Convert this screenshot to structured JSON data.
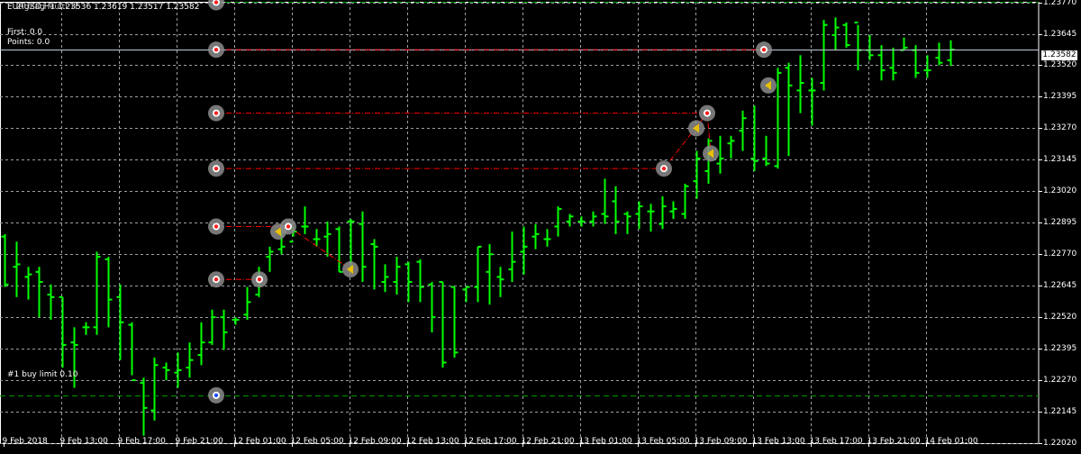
{
  "header": {
    "symbol_line": "EURUSD,H1  1.23536 1.23619 1.23517 1.23582",
    "title_overlay": "ZigZag Multi TF",
    "first_label": "First: 0.0",
    "points_label": "Points: 0.0"
  },
  "order": {
    "label": "#1 buy limit 0.10",
    "price": 1.2221
  },
  "colors": {
    "background": "#000000",
    "bar": "#00ff00",
    "grid": "#9aa0a6",
    "current_price_line": "#c0c8d8",
    "zigzag_line": "#ff0000",
    "order_line": "#009900"
  },
  "chart_data": {
    "type": "ohlc",
    "symbol": "EURUSD",
    "timeframe": "H1",
    "current_price": 1.23582,
    "current_price_label": "1.23582",
    "ylim": [
      1.2202,
      1.23772
    ],
    "y_ticks": [
      "1.23770",
      "1.23645",
      "1.23520",
      "1.23395",
      "1.23270",
      "1.23145",
      "1.23020",
      "1.22895",
      "1.22770",
      "1.22645",
      "1.22520",
      "1.22395",
      "1.22270",
      "1.22145",
      "1.22020"
    ],
    "x_labels": [
      "9 Feb 2018",
      "9 Feb 13:00",
      "9 Feb 17:00",
      "9 Feb 21:00",
      "12 Feb 01:00",
      "12 Feb 05:00",
      "12 Feb 09:00",
      "12 Feb 13:00",
      "12 Feb 17:00",
      "12 Feb 21:00",
      "13 Feb 01:00",
      "13 Feb 05:00",
      "13 Feb 09:00",
      "13 Feb 13:00",
      "13 Feb 17:00",
      "13 Feb 21:00",
      "14 Feb 01:00"
    ],
    "bars": [
      [
        1.2284,
        1.2285,
        1.2264,
        1.2265
      ],
      [
        1.2272,
        1.2282,
        1.226,
        1.2273
      ],
      [
        1.2268,
        1.2272,
        1.2259,
        1.2269
      ],
      [
        1.227,
        1.2272,
        1.2252,
        1.2266
      ],
      [
        1.2261,
        1.2265,
        1.2251,
        1.226
      ],
      [
        1.226,
        1.226,
        1.2232,
        1.2241
      ],
      [
        1.2242,
        1.2248,
        1.2224,
        1.2241
      ],
      [
        1.2248,
        1.225,
        1.2245,
        1.2248
      ],
      [
        1.2248,
        1.2278,
        1.2245,
        1.2276
      ],
      [
        1.2275,
        1.2276,
        1.2248,
        1.2259
      ],
      [
        1.226,
        1.2265,
        1.2235,
        1.225
      ],
      [
        1.2249,
        1.225,
        1.2229,
        1.2227
      ],
      [
        1.2226,
        1.2228,
        1.2205,
        1.2216
      ],
      [
        1.2215,
        1.2236,
        1.2211,
        1.2233
      ],
      [
        1.2232,
        1.2234,
        1.2227,
        1.2231
      ],
      [
        1.223,
        1.2238,
        1.2224,
        1.2231
      ],
      [
        1.2232,
        1.2242,
        1.2228,
        1.2235
      ],
      [
        1.2237,
        1.225,
        1.2233,
        1.2242
      ],
      [
        1.2242,
        1.2255,
        1.2241,
        1.2252
      ],
      [
        1.2252,
        1.2255,
        1.2239,
        1.2246
      ],
      [
        1.2251,
        1.2252,
        1.2249,
        1.2251
      ],
      [
        1.2253,
        1.2264,
        1.2251,
        1.2258
      ],
      [
        1.2261,
        1.2272,
        1.226,
        1.2268
      ],
      [
        1.2276,
        1.228,
        1.227,
        1.2278
      ],
      [
        1.2279,
        1.2286,
        1.2277,
        1.228
      ],
      [
        1.2282,
        1.2288,
        1.2284,
        1.2286
      ],
      [
        1.2288,
        1.2296,
        1.2285,
        1.2288
      ],
      [
        1.2283,
        1.2287,
        1.228,
        1.2283
      ],
      [
        1.2284,
        1.229,
        1.2276,
        1.2285
      ],
      [
        1.2287,
        1.2288,
        1.227,
        1.227
      ],
      [
        1.229,
        1.2291,
        1.2271,
        1.229
      ],
      [
        1.2289,
        1.2294,
        1.2266,
        1.2272
      ],
      [
        1.2281,
        1.2283,
        1.2263,
        1.228
      ],
      [
        1.2266,
        1.2273,
        1.2262,
        1.2268
      ],
      [
        1.2266,
        1.2276,
        1.2261,
        1.2272
      ],
      [
        1.2273,
        1.2274,
        1.2258,
        1.2266
      ],
      [
        1.2274,
        1.2275,
        1.2258,
        1.2264
      ],
      [
        1.2265,
        1.2266,
        1.2246,
        1.2252
      ],
      [
        1.2266,
        1.2266,
        1.2232,
        1.2234
      ],
      [
        1.2264,
        1.2264,
        1.2236,
        1.2238
      ],
      [
        1.2263,
        1.2264,
        1.2258,
        1.2264
      ],
      [
        1.2264,
        1.228,
        1.2258,
        1.228
      ],
      [
        1.227,
        1.2281,
        1.2257,
        1.2277
      ],
      [
        1.2268,
        1.2272,
        1.226,
        1.2267
      ],
      [
        1.2271,
        1.2286,
        1.2266,
        1.2274
      ],
      [
        1.2278,
        1.2288,
        1.2269,
        1.228
      ],
      [
        1.2284,
        1.2289,
        1.2279,
        1.2285
      ],
      [
        1.2283,
        1.2287,
        1.228,
        1.2283
      ],
      [
        1.2288,
        1.2296,
        1.2284,
        1.2295
      ],
      [
        1.229,
        1.2293,
        1.2288,
        1.2292
      ],
      [
        1.229,
        1.2292,
        1.2288,
        1.229
      ],
      [
        1.229,
        1.2294,
        1.2288,
        1.2292
      ],
      [
        1.2293,
        1.2307,
        1.2289,
        1.2292
      ],
      [
        1.2298,
        1.2304,
        1.2285,
        1.229
      ],
      [
        1.2293,
        1.2294,
        1.2285,
        1.2292
      ],
      [
        1.2293,
        1.2298,
        1.2287,
        1.2296
      ],
      [
        1.2294,
        1.2297,
        1.2286,
        1.2294
      ],
      [
        1.2289,
        1.23,
        1.2287,
        1.2296
      ],
      [
        1.2294,
        1.2298,
        1.2291,
        1.2295
      ],
      [
        1.2293,
        1.2305,
        1.2291,
        1.2304
      ],
      [
        1.2306,
        1.2318,
        1.2299,
        1.2315
      ],
      [
        1.231,
        1.2323,
        1.2305,
        1.2322
      ],
      [
        1.2313,
        1.2324,
        1.2309,
        1.2315
      ],
      [
        1.2321,
        1.2324,
        1.2315,
        1.2322
      ],
      [
        1.2326,
        1.2334,
        1.2318,
        1.2331
      ],
      [
        1.2315,
        1.2336,
        1.231,
        1.2314
      ],
      [
        1.2315,
        1.2324,
        1.2312,
        1.2313
      ],
      [
        1.2312,
        1.2351,
        1.2311,
        1.2349
      ],
      [
        1.2351,
        1.2353,
        1.2316,
        1.2344
      ],
      [
        1.2342,
        1.2356,
        1.2333,
        1.2345
      ],
      [
        1.2342,
        1.2347,
        1.2328,
        1.2342
      ],
      [
        1.2345,
        1.237,
        1.2342,
        1.2368
      ],
      [
        1.2364,
        1.2371,
        1.2358,
        1.2367
      ],
      [
        1.2368,
        1.2369,
        1.2359,
        1.236
      ],
      [
        1.2369,
        1.2368,
        1.235,
        1.2358
      ],
      [
        1.2358,
        1.2364,
        1.2354,
        1.2356
      ],
      [
        1.2356,
        1.236,
        1.2346,
        1.235
      ],
      [
        1.2351,
        1.2359,
        1.2346,
        1.2349
      ],
      [
        1.2358,
        1.2363,
        1.2358,
        1.2359
      ],
      [
        1.2358,
        1.236,
        1.2347,
        1.2349
      ],
      [
        1.235,
        1.2356,
        1.2347,
        1.235
      ],
      [
        1.2355,
        1.2361,
        1.2352,
        1.2353
      ],
      [
        1.2354,
        1.23619,
        1.23517,
        1.23582
      ]
    ],
    "markers": [
      {
        "label_price": 1.2377,
        "kind": "level"
      },
      {
        "label_price": 1.23582,
        "kind": "level"
      },
      {
        "label_price": 1.2333,
        "kind": "level"
      },
      {
        "label_price": 1.2311,
        "kind": "level"
      },
      {
        "label_price": 1.2288,
        "kind": "level"
      },
      {
        "label_price": 1.2267,
        "kind": "level"
      },
      {
        "label_price": 1.2221,
        "kind": "order"
      }
    ]
  }
}
